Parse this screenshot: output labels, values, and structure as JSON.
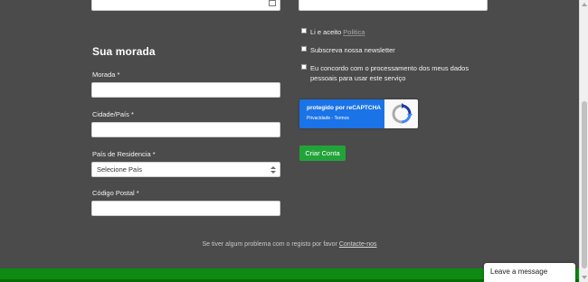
{
  "section": {
    "title": "Sua morada"
  },
  "fields": {
    "morada_label": "Morada *",
    "cidade_label": "Cidade/País *",
    "pais_label": "País de Residencia *",
    "pais_selected": "Selecione País",
    "codigo_label": "Código Postal *"
  },
  "checks": {
    "politica_prefix": "Li e aceito",
    "politica_link": "Politica",
    "newsletter": "Subscreva nossa newsletter",
    "consent": "Eu concordo com o processamento dos meus dados pessoais para usar este serviço"
  },
  "recaptcha": {
    "title": "protegido por reCAPTCHA",
    "links": "Privacidade - Termos",
    "icon": "recaptcha-logo-icon"
  },
  "submit": {
    "label": "Criar Conta"
  },
  "footer": {
    "note": "Se tiver algum problema com o registo por favor",
    "link": "Contacte-nos"
  },
  "chat": {
    "label": "Leave a message"
  },
  "colors": {
    "background": "#4b4b4b",
    "accent_green": "#22a33a",
    "bar_green": "#0e8a12",
    "recaptcha_blue": "#1b73e8"
  }
}
